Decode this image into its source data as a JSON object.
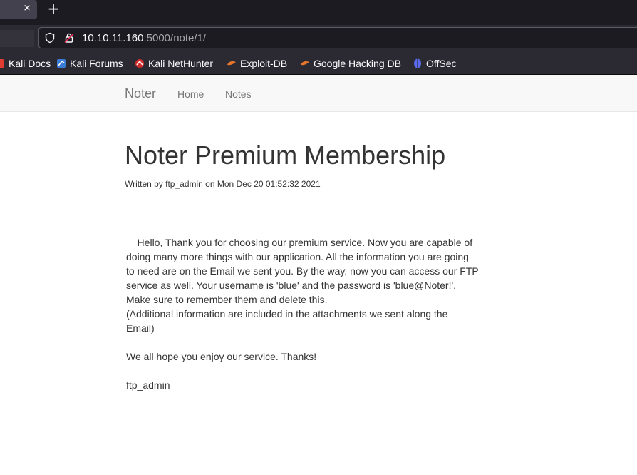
{
  "browser": {
    "tab": {
      "close_glyph": "×"
    },
    "new_tab_glyph": "+",
    "url": {
      "host": "10.10.11.160",
      "rest": ":5000/note/1/"
    },
    "bookmarks": [
      {
        "label": "Kali Docs",
        "icon": "kali-docs-icon"
      },
      {
        "label": "Kali Forums",
        "icon": "kali-forums-icon"
      },
      {
        "label": "Kali NetHunter",
        "icon": "kali-nethunter-icon"
      },
      {
        "label": "Exploit-DB",
        "icon": "exploit-db-icon"
      },
      {
        "label": "Google Hacking DB",
        "icon": "google-hacking-db-icon"
      },
      {
        "label": "OffSec",
        "icon": "offsec-icon"
      }
    ]
  },
  "site_nav": {
    "brand": "Noter",
    "links": [
      "Home",
      "Notes"
    ]
  },
  "note": {
    "title": "Noter Premium Membership",
    "meta": "Written by ftp_admin on Mon Dec 20 01:52:32 2021",
    "body_lines": [
      "    Hello, Thank you for choosing our premium service. Now you are capable of",
      "doing many more things with our application. All the information you are going",
      "to need are on the Email we sent you. By the way, now you can access our FTP",
      "service as well. Your username is 'blue' and the password is 'blue@Noter!'.",
      "Make sure to remember them and delete this.",
      "(Additional information are included in the attachments we sent along the",
      "Email)",
      "",
      "We all hope you enjoy our service. Thanks!",
      "",
      "ftp_admin"
    ]
  },
  "colors": {
    "tabstrip": "#1c1b22",
    "toolbar": "#2b2a33",
    "navbar": "#f8f8f8",
    "text": "#333333",
    "nav_text": "#777777"
  }
}
